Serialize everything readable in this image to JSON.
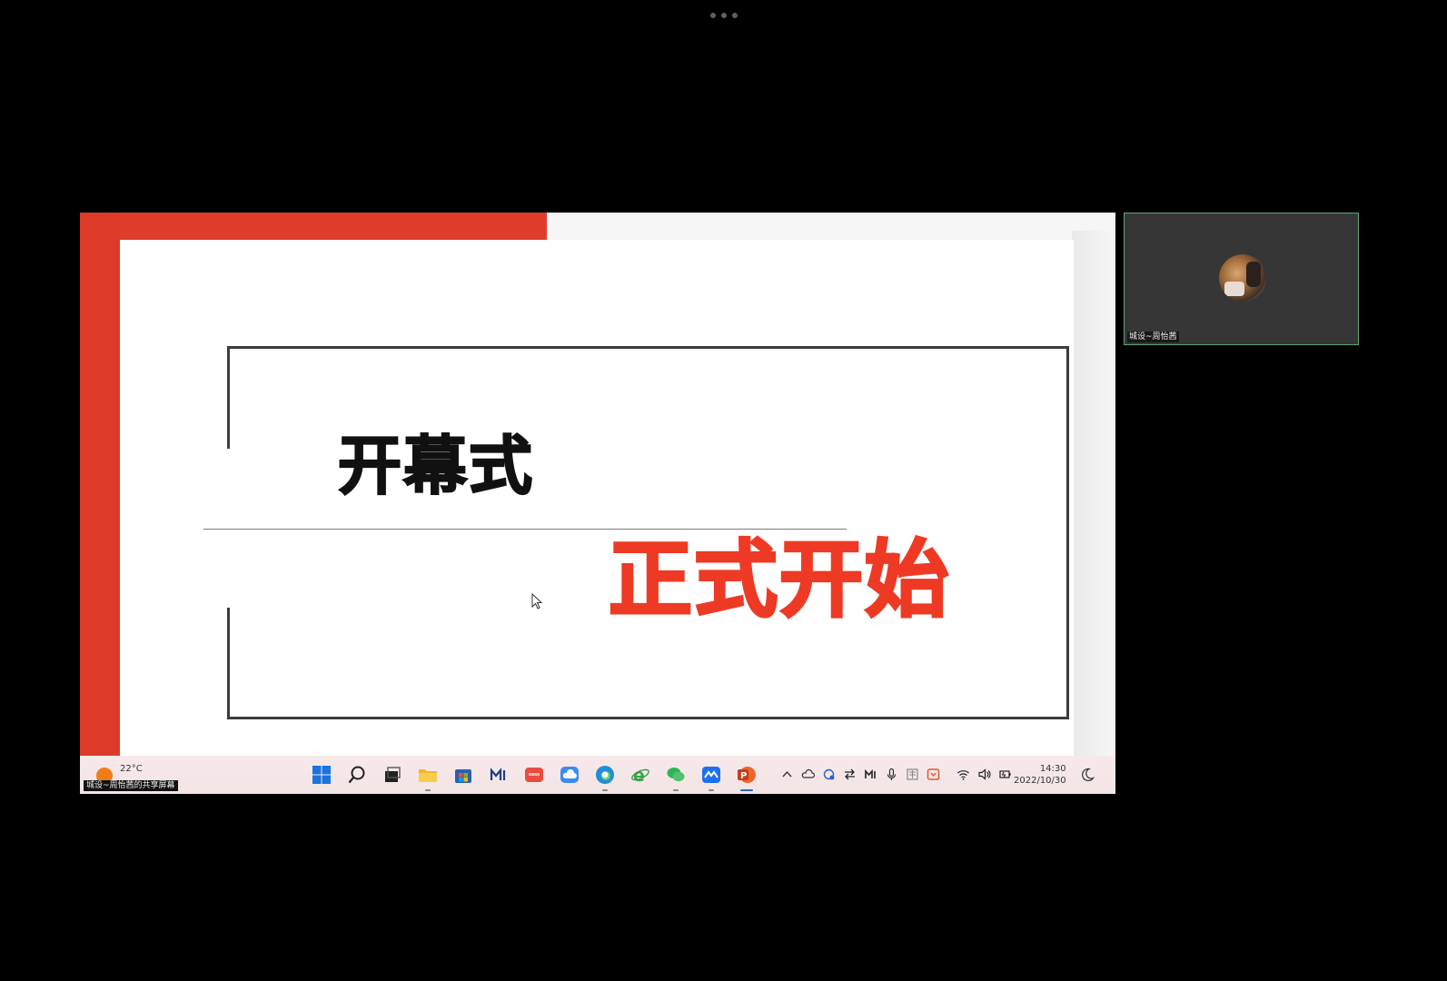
{
  "meeting": {
    "more_menu_icon": "more-horizontal-icon"
  },
  "slide": {
    "title": "开幕式",
    "subtitle": "正式开始",
    "colors": {
      "accent": "#e13d2c",
      "title": "#111111",
      "subtitle": "#ee3a24"
    }
  },
  "taskbar": {
    "weather": {
      "temp": "22°C",
      "icon": "sun-icon"
    },
    "apps": [
      {
        "name": "windows-start",
        "icon": "windows-logo-icon"
      },
      {
        "name": "search",
        "icon": "search-icon"
      },
      {
        "name": "task-view",
        "icon": "task-view-icon"
      },
      {
        "name": "file-explorer",
        "icon": "folder-icon"
      },
      {
        "name": "microsoft-store",
        "icon": "store-icon"
      },
      {
        "name": "app-m",
        "icon": "m-app-icon"
      },
      {
        "name": "app-red",
        "icon": "red-app-icon"
      },
      {
        "name": "cloud-drive",
        "icon": "cloud-app-icon"
      },
      {
        "name": "edge",
        "icon": "edge-browser-icon"
      },
      {
        "name": "internet-explorer",
        "icon": "ie-browser-icon"
      },
      {
        "name": "wechat",
        "icon": "wechat-icon"
      },
      {
        "name": "tencent-meeting",
        "icon": "meeting-app-icon"
      },
      {
        "name": "powerpoint",
        "icon": "powerpoint-icon"
      }
    ],
    "tray_icons": [
      "chevron-up-icon",
      "cloud-icon",
      "sync-icon",
      "transfer-icon",
      "m-tray-icon",
      "microphone-icon",
      "ime-icon",
      "wps-icon",
      "wifi-icon",
      "volume-icon",
      "battery-icon"
    ],
    "clock": {
      "time": "14:30",
      "date": "2022/10/30"
    },
    "share_caption": "城设~周怡茜的共享屏幕"
  },
  "participant": {
    "name": "城设~周怡茜"
  }
}
